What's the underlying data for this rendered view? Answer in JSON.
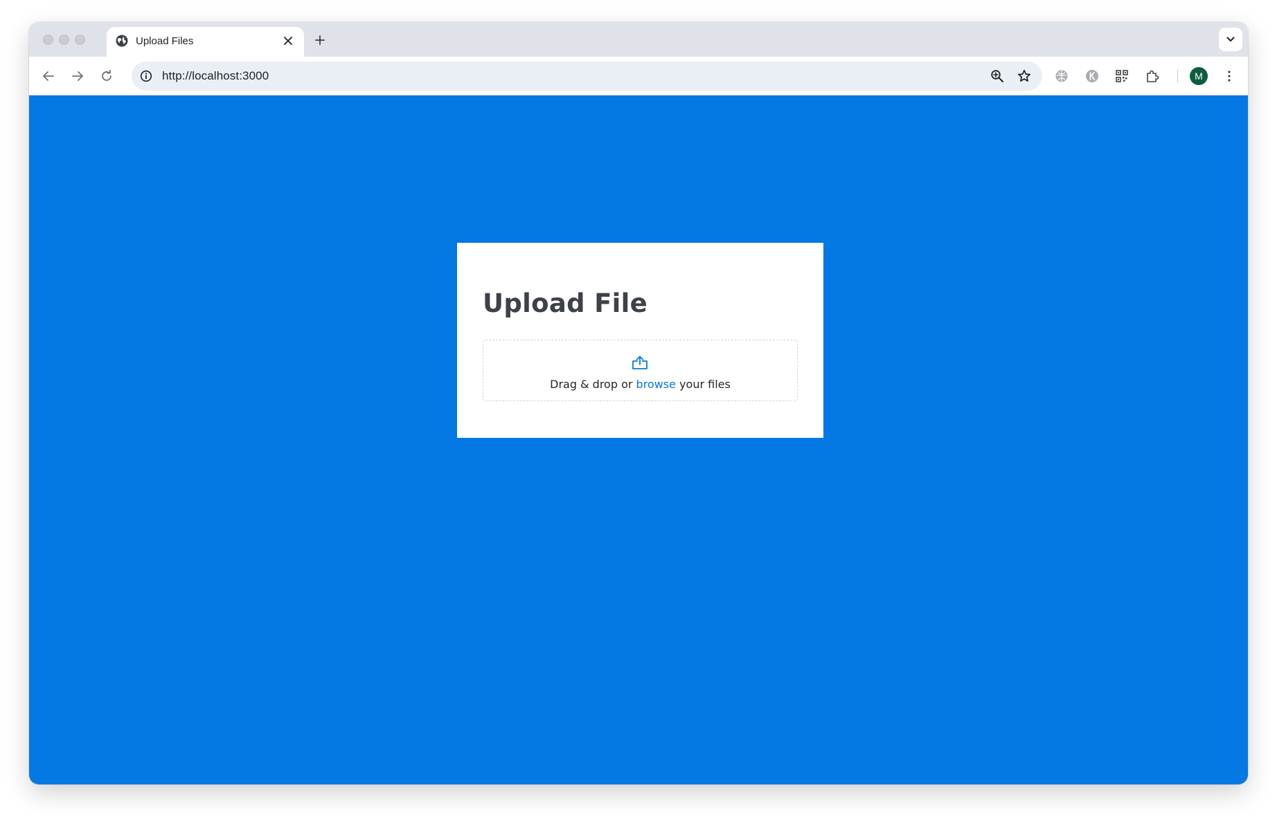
{
  "browser": {
    "tab": {
      "title": "Upload Files",
      "favicon": "globe-icon"
    },
    "address": {
      "url": "http://localhost:3000"
    },
    "profile": {
      "initial": "M",
      "color": "#0d5c3e"
    }
  },
  "page": {
    "background_color": "#0478e3",
    "card": {
      "title": "Upload File",
      "dropzone": {
        "icon": "upload-icon",
        "text_before": "Drag & drop or ",
        "link_text": "browse",
        "text_after": " your files",
        "link_color": "#0478e3"
      }
    }
  }
}
